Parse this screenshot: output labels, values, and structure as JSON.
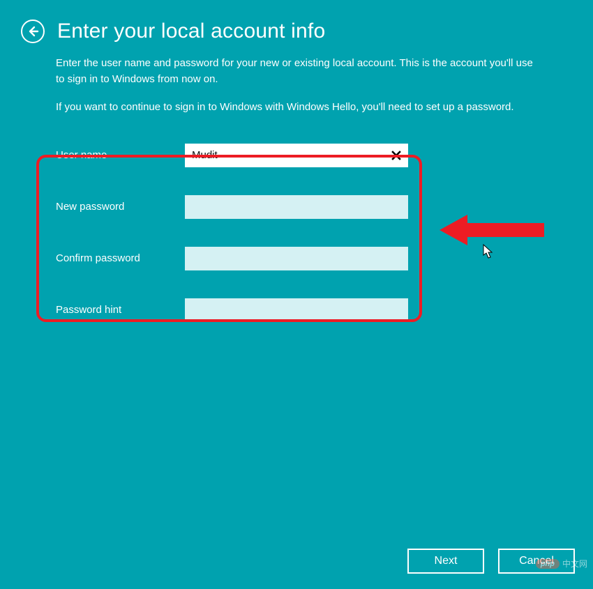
{
  "header": {
    "title": "Enter your local account info"
  },
  "description": {
    "p1": "Enter the user name and password for your new or existing local account. This is the account you'll use to sign in to Windows from now on.",
    "p2": "If you want to continue to sign in to Windows with Windows Hello, you'll need to set up a password."
  },
  "form": {
    "username": {
      "label": "User name",
      "value": "Mudit"
    },
    "new_password": {
      "label": "New password",
      "value": ""
    },
    "confirm_password": {
      "label": "Confirm password",
      "value": ""
    },
    "password_hint": {
      "label": "Password hint",
      "value": ""
    }
  },
  "footer": {
    "next": "Next",
    "cancel": "Cancel"
  },
  "watermark": {
    "badge": "php",
    "text": "中文网"
  }
}
